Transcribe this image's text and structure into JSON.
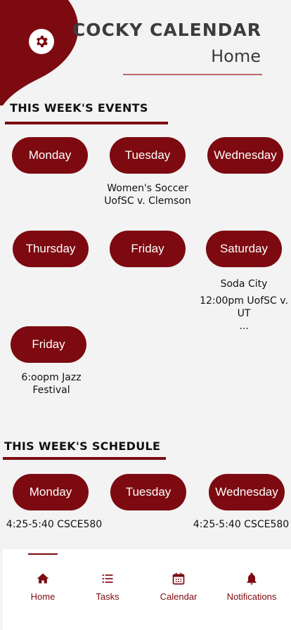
{
  "header": {
    "app_title": "COCKY CALENDAR",
    "page_title": "Home",
    "settings_icon": "gear-icon"
  },
  "events": {
    "heading": "THIS WEEK'S EVENTS",
    "days": [
      {
        "label": "Monday",
        "lines": []
      },
      {
        "label": "Tuesday",
        "lines": [
          "Women's Soccer",
          "UofSC v. Clemson"
        ]
      },
      {
        "label": "Wednesday",
        "lines": []
      },
      {
        "label": "Thursday",
        "lines": []
      },
      {
        "label": "Friday",
        "lines": []
      },
      {
        "label": "Saturday",
        "lines": [
          "Soda City",
          "12:00pm UofSC v.",
          "UT",
          "..."
        ]
      },
      {
        "label": "Friday",
        "lines": [
          "6:oopm Jazz",
          "Festival"
        ]
      }
    ]
  },
  "schedule": {
    "heading": "THIS WEEK'S SCHEDULE",
    "days": [
      {
        "label": "Monday",
        "lines": [
          "4:25-5:40 CSCE580"
        ]
      },
      {
        "label": "Tuesday",
        "lines": []
      },
      {
        "label": "Wednesday",
        "lines": [
          "4:25-5:40 CSCE580"
        ]
      }
    ]
  },
  "nav": {
    "items": [
      {
        "label": "Home",
        "icon": "home-icon"
      },
      {
        "label": "Tasks",
        "icon": "list-icon"
      },
      {
        "label": "Calendar",
        "icon": "calendar-icon"
      },
      {
        "label": "Notifications",
        "icon": "bell-icon"
      }
    ],
    "active": "Home"
  },
  "colors": {
    "accent": "#7c0a10",
    "background": "#f3f3f3",
    "text": "#3c3c3c"
  }
}
